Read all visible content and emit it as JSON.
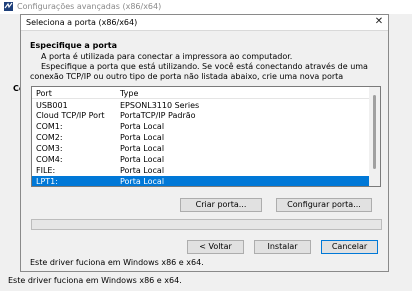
{
  "outer_window": {
    "title": "Configurações avançadas (x86/x64)",
    "fragment": "Co",
    "footer_text": "Este driver fuciona em Windows x86 e x64."
  },
  "dialog": {
    "title": "Seleciona a porta (x86/x64)",
    "heading": "Especifique a porta",
    "line1": "A porta é utilizada para conectar a impressora ao computador.",
    "line2": "Especifique a porta que está utilizando. Se você está conectando através de uma",
    "line3": "conexão TCP/IP ou outro tipo de porta não listada abaixo, crie uma nova porta",
    "list": {
      "headers": [
        "Port",
        "Type"
      ],
      "rows": [
        {
          "port": "USB001",
          "type": "EPSONL3110 Series"
        },
        {
          "port": "Cloud TCP/IP Port",
          "type": "PortaTCP/IP Padrão"
        },
        {
          "port": "COM1:",
          "type": "Porta Local"
        },
        {
          "port": "COM2:",
          "type": "Porta Local"
        },
        {
          "port": "COM3:",
          "type": "Porta Local"
        },
        {
          "port": "COM4:",
          "type": "Porta Local"
        },
        {
          "port": "FILE:",
          "type": "Porta Local"
        },
        {
          "port": "LPT1:",
          "type": "Porta Local"
        }
      ],
      "selected_port": "LPT1:"
    },
    "create_port_label": "Criar porta...",
    "configure_port_label": "Configurar porta...",
    "driver_text": "Este driver fuciona em Windows x86 e x64.",
    "back_label": "< Voltar",
    "install_label": "Instalar",
    "cancel_label": "Cancelar",
    "close_glyph": "✕"
  },
  "colors": {
    "selection": "#0078d7",
    "window_bg": "#f0f0f0",
    "button_bg": "#e1e1e1"
  }
}
